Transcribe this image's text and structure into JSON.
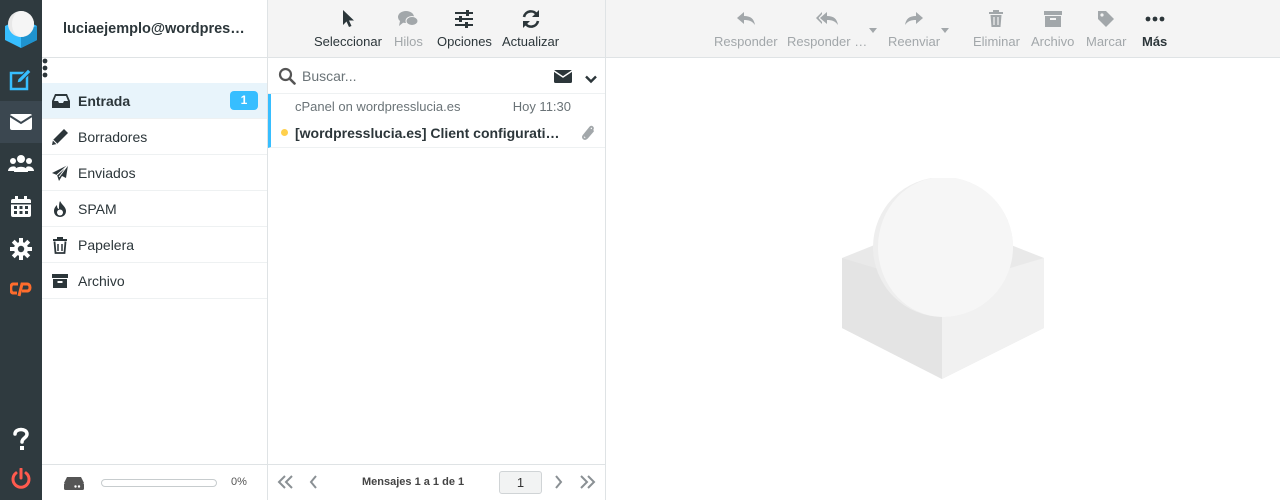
{
  "account": {
    "email": "luciaejemplo@wordpresslu…"
  },
  "nav": {
    "items": [
      "compose",
      "mail",
      "contacts",
      "calendar",
      "settings",
      "cpanel",
      "help",
      "logout"
    ]
  },
  "folders": [
    {
      "label": "Entrada",
      "icon": "inbox-icon",
      "badge": "1",
      "selected": true
    },
    {
      "label": "Borradores",
      "icon": "pencil-icon"
    },
    {
      "label": "Enviados",
      "icon": "paper-plane-icon"
    },
    {
      "label": "SPAM",
      "icon": "fire-icon"
    },
    {
      "label": "Papelera",
      "icon": "trash-icon"
    },
    {
      "label": "Archivo",
      "icon": "archive-box-icon"
    }
  ],
  "quota": {
    "percent_label": "0%",
    "fraction": 0
  },
  "list_toolbar": {
    "select": "Seleccionar",
    "threads": "Hilos",
    "options": "Opciones",
    "refresh": "Actualizar"
  },
  "search": {
    "placeholder": "Buscar..."
  },
  "messages": [
    {
      "from": "cPanel on wordpresslucia.es",
      "date": "Hoy 11:30",
      "subject": "[wordpresslucia.es] Client configuration s…",
      "unread": true,
      "has_attachment": true
    }
  ],
  "pager": {
    "info": "Mensajes 1 a 1 de 1",
    "page": "1"
  },
  "preview_toolbar": {
    "reply": "Responder",
    "reply_all": "Responder …",
    "forward": "Reenviar",
    "delete": "Eliminar",
    "archive": "Archivo",
    "mark": "Marcar",
    "more": "Más"
  },
  "colors": {
    "accent": "#37beff",
    "nav_bg": "#2f3a3f",
    "compose": "#37beff",
    "cpanel": "#ff6c2c",
    "logout": "#ff5a4e",
    "unread_dot": "#ffd04c"
  }
}
